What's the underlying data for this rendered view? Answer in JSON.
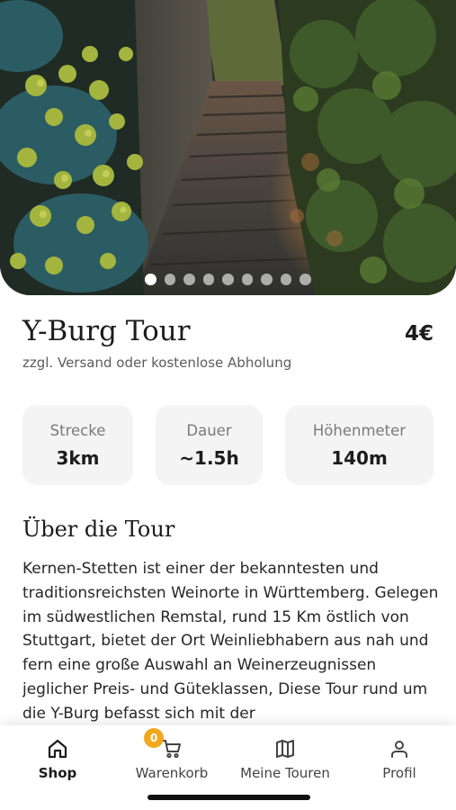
{
  "hero": {
    "image_icon": "stone-stairs-vineyard-photo",
    "slide_count": 9,
    "active_slide": 1
  },
  "product": {
    "title": "Y-Burg Tour",
    "price": "4€",
    "subtitle": "zzgl. Versand oder kostenlose Abholung"
  },
  "stats": [
    {
      "label": "Strecke",
      "value": "3km"
    },
    {
      "label": "Dauer",
      "value": "~1.5h"
    },
    {
      "label": "Höhenmeter",
      "value": "140m"
    }
  ],
  "about": {
    "heading": "Über die Tour",
    "text": "Kernen-Stetten ist einer der bekanntesten und traditionsreichsten Weinorte in Württemberg. Gelegen im südwestlichen Remstal, rund 15 Km östlich von Stuttgart, bietet der Ort Weinliebhabern aus nah und fern eine große Auswahl an Weinerzeugnissen jeglicher Preis- und Güteklassen, Diese Tour rund um die Y-Burg befasst sich mit der"
  },
  "nav": {
    "active": "shop",
    "cart_count": "0",
    "tabs": [
      {
        "id": "shop",
        "label": "Shop",
        "icon": "home-icon"
      },
      {
        "id": "cart",
        "label": "Warenkorb",
        "icon": "cart-icon"
      },
      {
        "id": "tours",
        "label": "Meine Touren",
        "icon": "map-icon"
      },
      {
        "id": "profile",
        "label": "Profil",
        "icon": "user-icon"
      }
    ]
  },
  "colors": {
    "badge": "#f2a81d",
    "card_bg": "#f4f4f4",
    "text": "#1c1c1c"
  }
}
